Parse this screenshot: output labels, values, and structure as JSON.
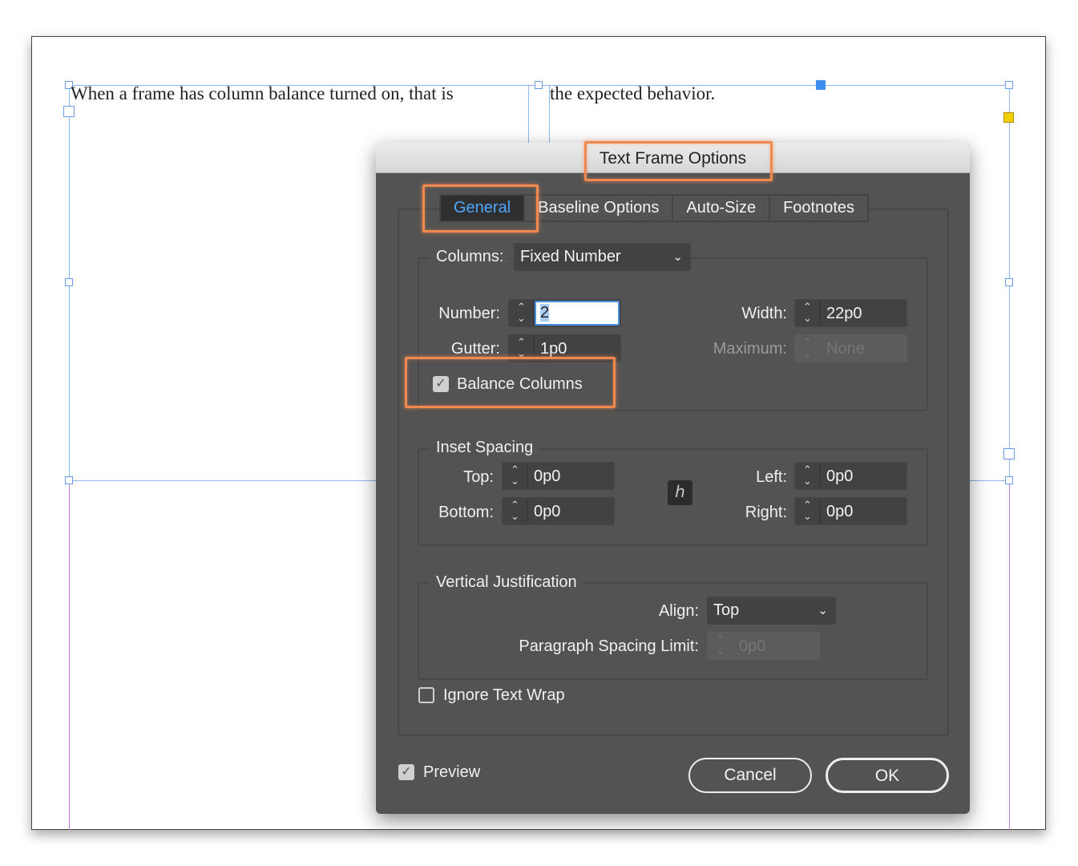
{
  "document": {
    "text_col1": "When a frame has column balance turned on, that is",
    "text_col2": "the expected behavior."
  },
  "dialog": {
    "title": "Text Frame Options",
    "tabs": [
      {
        "label": "General",
        "active": true
      },
      {
        "label": "Baseline Options"
      },
      {
        "label": "Auto-Size"
      },
      {
        "label": "Footnotes"
      }
    ],
    "columns": {
      "label": "Columns:",
      "type_value": "Fixed Number",
      "number_label": "Number:",
      "number_value": "2",
      "width_label": "Width:",
      "width_value": "22p0",
      "gutter_label": "Gutter:",
      "gutter_value": "1p0",
      "maximum_label": "Maximum:",
      "maximum_value": "None",
      "balance_label": "Balance Columns",
      "balance_checked": true
    },
    "inset": {
      "legend": "Inset Spacing",
      "top_label": "Top:",
      "top_value": "0p0",
      "bottom_label": "Bottom:",
      "bottom_value": "0p0",
      "left_label": "Left:",
      "left_value": "0p0",
      "right_label": "Right:",
      "right_value": "0p0",
      "link_icon": "chain-link-icon"
    },
    "vertical": {
      "legend": "Vertical Justification",
      "align_label": "Align:",
      "align_value": "Top",
      "psl_label": "Paragraph Spacing Limit:",
      "psl_value": "0p0"
    },
    "ignore_wrap_label": "Ignore Text Wrap",
    "ignore_wrap_checked": false,
    "preview_label": "Preview",
    "preview_checked": true,
    "cancel_label": "Cancel",
    "ok_label": "OK"
  },
  "colors": {
    "highlight": "#f0894f",
    "active_tab": "#4da6ff",
    "dialog_bg": "#535353"
  }
}
